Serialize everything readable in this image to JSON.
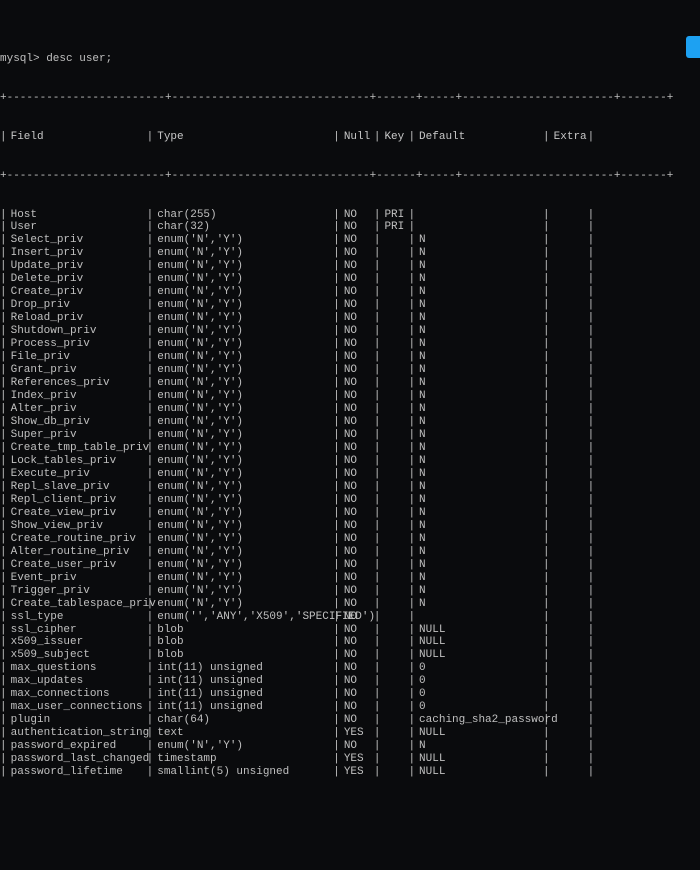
{
  "prompt": "mysql> desc user;",
  "columns": {
    "field": "Field",
    "type": "Type",
    "null": "Null",
    "key": "Key",
    "default": "Default",
    "extra": "Extra"
  },
  "rows": [
    {
      "field": "Host",
      "type": "char(255)",
      "null": "NO",
      "key": "PRI",
      "default": "",
      "extra": ""
    },
    {
      "field": "User",
      "type": "char(32)",
      "null": "NO",
      "key": "PRI",
      "default": "",
      "extra": ""
    },
    {
      "field": "Select_priv",
      "type": "enum('N','Y')",
      "null": "NO",
      "key": "",
      "default": "N",
      "extra": ""
    },
    {
      "field": "Insert_priv",
      "type": "enum('N','Y')",
      "null": "NO",
      "key": "",
      "default": "N",
      "extra": ""
    },
    {
      "field": "Update_priv",
      "type": "enum('N','Y')",
      "null": "NO",
      "key": "",
      "default": "N",
      "extra": ""
    },
    {
      "field": "Delete_priv",
      "type": "enum('N','Y')",
      "null": "NO",
      "key": "",
      "default": "N",
      "extra": ""
    },
    {
      "field": "Create_priv",
      "type": "enum('N','Y')",
      "null": "NO",
      "key": "",
      "default": "N",
      "extra": ""
    },
    {
      "field": "Drop_priv",
      "type": "enum('N','Y')",
      "null": "NO",
      "key": "",
      "default": "N",
      "extra": ""
    },
    {
      "field": "Reload_priv",
      "type": "enum('N','Y')",
      "null": "NO",
      "key": "",
      "default": "N",
      "extra": ""
    },
    {
      "field": "Shutdown_priv",
      "type": "enum('N','Y')",
      "null": "NO",
      "key": "",
      "default": "N",
      "extra": ""
    },
    {
      "field": "Process_priv",
      "type": "enum('N','Y')",
      "null": "NO",
      "key": "",
      "default": "N",
      "extra": ""
    },
    {
      "field": "File_priv",
      "type": "enum('N','Y')",
      "null": "NO",
      "key": "",
      "default": "N",
      "extra": ""
    },
    {
      "field": "Grant_priv",
      "type": "enum('N','Y')",
      "null": "NO",
      "key": "",
      "default": "N",
      "extra": ""
    },
    {
      "field": "References_priv",
      "type": "enum('N','Y')",
      "null": "NO",
      "key": "",
      "default": "N",
      "extra": ""
    },
    {
      "field": "Index_priv",
      "type": "enum('N','Y')",
      "null": "NO",
      "key": "",
      "default": "N",
      "extra": ""
    },
    {
      "field": "Alter_priv",
      "type": "enum('N','Y')",
      "null": "NO",
      "key": "",
      "default": "N",
      "extra": ""
    },
    {
      "field": "Show_db_priv",
      "type": "enum('N','Y')",
      "null": "NO",
      "key": "",
      "default": "N",
      "extra": ""
    },
    {
      "field": "Super_priv",
      "type": "enum('N','Y')",
      "null": "NO",
      "key": "",
      "default": "N",
      "extra": ""
    },
    {
      "field": "Create_tmp_table_priv",
      "type": "enum('N','Y')",
      "null": "NO",
      "key": "",
      "default": "N",
      "extra": ""
    },
    {
      "field": "Lock_tables_priv",
      "type": "enum('N','Y')",
      "null": "NO",
      "key": "",
      "default": "N",
      "extra": ""
    },
    {
      "field": "Execute_priv",
      "type": "enum('N','Y')",
      "null": "NO",
      "key": "",
      "default": "N",
      "extra": ""
    },
    {
      "field": "Repl_slave_priv",
      "type": "enum('N','Y')",
      "null": "NO",
      "key": "",
      "default": "N",
      "extra": ""
    },
    {
      "field": "Repl_client_priv",
      "type": "enum('N','Y')",
      "null": "NO",
      "key": "",
      "default": "N",
      "extra": ""
    },
    {
      "field": "Create_view_priv",
      "type": "enum('N','Y')",
      "null": "NO",
      "key": "",
      "default": "N",
      "extra": ""
    },
    {
      "field": "Show_view_priv",
      "type": "enum('N','Y')",
      "null": "NO",
      "key": "",
      "default": "N",
      "extra": ""
    },
    {
      "field": "Create_routine_priv",
      "type": "enum('N','Y')",
      "null": "NO",
      "key": "",
      "default": "N",
      "extra": ""
    },
    {
      "field": "Alter_routine_priv",
      "type": "enum('N','Y')",
      "null": "NO",
      "key": "",
      "default": "N",
      "extra": ""
    },
    {
      "field": "Create_user_priv",
      "type": "enum('N','Y')",
      "null": "NO",
      "key": "",
      "default": "N",
      "extra": ""
    },
    {
      "field": "Event_priv",
      "type": "enum('N','Y')",
      "null": "NO",
      "key": "",
      "default": "N",
      "extra": ""
    },
    {
      "field": "Trigger_priv",
      "type": "enum('N','Y')",
      "null": "NO",
      "key": "",
      "default": "N",
      "extra": ""
    },
    {
      "field": "Create_tablespace_priv",
      "type": "enum('N','Y')",
      "null": "NO",
      "key": "",
      "default": "N",
      "extra": ""
    },
    {
      "field": "ssl_type",
      "type": "enum('','ANY','X509','SPECIFIED')",
      "null": "NO",
      "key": "",
      "default": "",
      "extra": ""
    },
    {
      "field": "ssl_cipher",
      "type": "blob",
      "null": "NO",
      "key": "",
      "default": "NULL",
      "extra": ""
    },
    {
      "field": "x509_issuer",
      "type": "blob",
      "null": "NO",
      "key": "",
      "default": "NULL",
      "extra": ""
    },
    {
      "field": "x509_subject",
      "type": "blob",
      "null": "NO",
      "key": "",
      "default": "NULL",
      "extra": ""
    },
    {
      "field": "max_questions",
      "type": "int(11) unsigned",
      "null": "NO",
      "key": "",
      "default": "0",
      "extra": ""
    },
    {
      "field": "max_updates",
      "type": "int(11) unsigned",
      "null": "NO",
      "key": "",
      "default": "0",
      "extra": ""
    },
    {
      "field": "max_connections",
      "type": "int(11) unsigned",
      "null": "NO",
      "key": "",
      "default": "0",
      "extra": ""
    },
    {
      "field": "max_user_connections",
      "type": "int(11) unsigned",
      "null": "NO",
      "key": "",
      "default": "0",
      "extra": ""
    },
    {
      "field": "plugin",
      "type": "char(64)",
      "null": "NO",
      "key": "",
      "default": "caching_sha2_password",
      "extra": ""
    },
    {
      "field": "authentication_string",
      "type": "text",
      "null": "YES",
      "key": "",
      "default": "NULL",
      "extra": ""
    },
    {
      "field": "password_expired",
      "type": "enum('N','Y')",
      "null": "NO",
      "key": "",
      "default": "N",
      "extra": ""
    },
    {
      "field": "password_last_changed",
      "type": "timestamp",
      "null": "YES",
      "key": "",
      "default": "NULL",
      "extra": ""
    },
    {
      "field": "password_lifetime",
      "type": "smallint(5) unsigned",
      "null": "YES",
      "key": "",
      "default": "NULL",
      "extra": ""
    }
  ],
  "separators": {
    "top": "+------------------------+------------------------------+------+-----+-----------------------+-------+",
    "header": "+------------------------+------------------------------+------+-----+-----------------------+-------+"
  }
}
